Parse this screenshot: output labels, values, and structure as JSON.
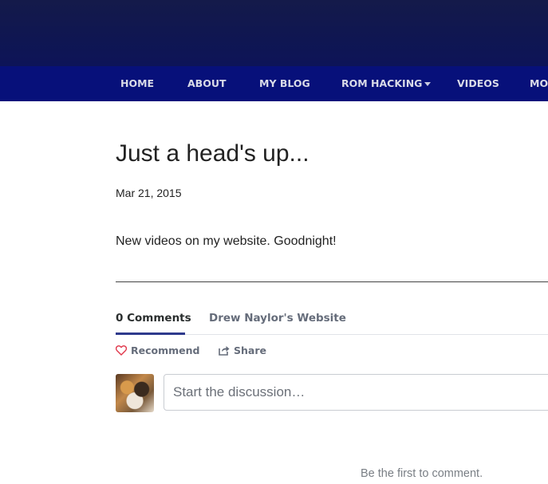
{
  "nav": {
    "items": [
      {
        "label": "HOME"
      },
      {
        "label": "ABOUT"
      },
      {
        "label": "MY BLOG"
      },
      {
        "label": "ROM HACKING"
      },
      {
        "label": "VIDEOS"
      },
      {
        "label": "MO"
      }
    ]
  },
  "post": {
    "title": "Just a head's up...",
    "date": "Mar 21, 2015",
    "body": "New videos on my website. Goodnight!"
  },
  "comments": {
    "tab_comments": "0 Comments",
    "tab_site": "Drew Naylor's Website",
    "recommend_label": "Recommend",
    "share_label": "Share",
    "discussion_placeholder": "Start the discussion…",
    "empty_message": "Be the first to comment.",
    "icons": {
      "recommend": "heart-icon",
      "share": "share-icon",
      "dropdown": "chevron-down-icon"
    },
    "colors": {
      "heart": "#e0364a",
      "nav_bg": "#07107a",
      "header_bg": "#141a4a"
    }
  }
}
